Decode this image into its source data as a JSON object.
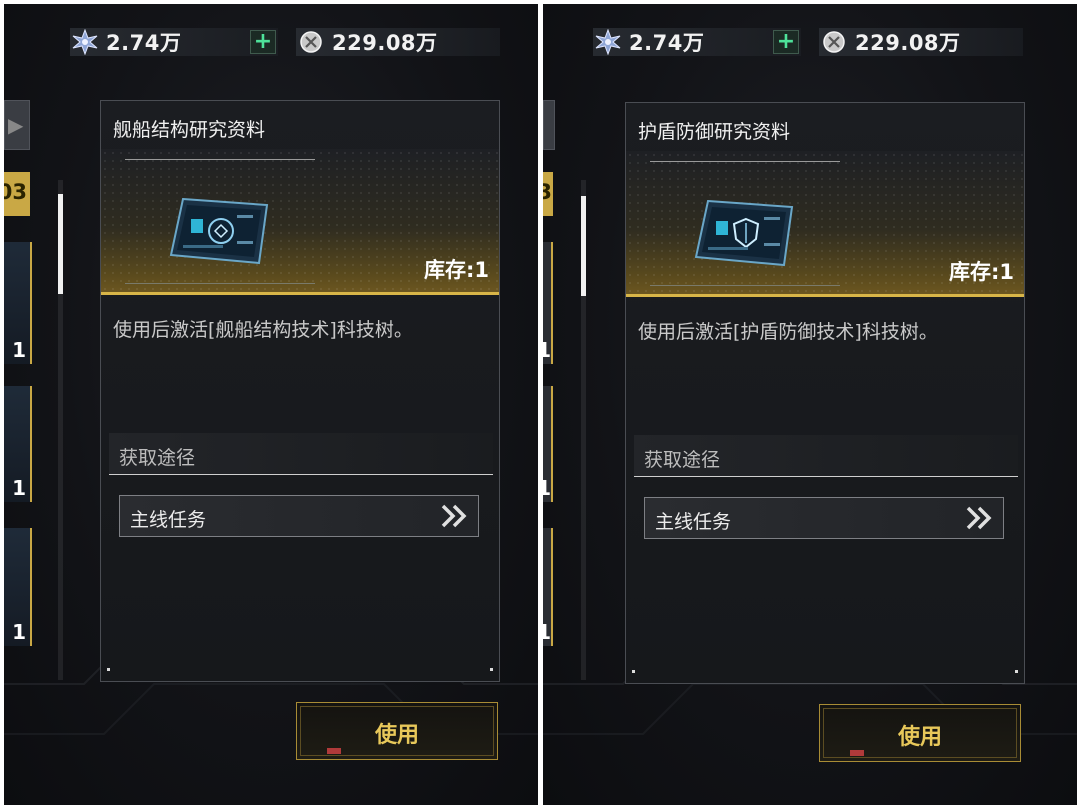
{
  "panels": [
    {
      "resources": {
        "crystal_value": "2.74万",
        "coin_value": "229.08万"
      },
      "item": {
        "name": "舰船结构研究资料",
        "stock": "库存:1",
        "description": "使用后激活[舰船结构技术]科技树。"
      },
      "source": {
        "header": "获取途径",
        "entries": [
          {
            "label": "主线任务"
          }
        ]
      },
      "use_button": "使用",
      "strip": {
        "top_label": "03",
        "counts": [
          "1",
          "1",
          "1"
        ]
      }
    },
    {
      "resources": {
        "crystal_value": "2.74万",
        "coin_value": "229.08万"
      },
      "item": {
        "name": "护盾防御研究资料",
        "stock": "库存:1",
        "description": "使用后激活[护盾防御技术]科技树。"
      },
      "source": {
        "header": "获取途径",
        "entries": [
          {
            "label": "主线任务"
          }
        ]
      },
      "use_button": "使用",
      "strip": {
        "top_label": "3",
        "counts": [
          "1",
          "1",
          "1"
        ]
      }
    }
  ],
  "icons": {
    "crystal": "star-crystal-icon",
    "coin": "coin-icon",
    "plus": "plus-icon",
    "chevron": "double-chevron-right-icon"
  },
  "colors": {
    "accent_gold": "#d8b548",
    "plus_green": "#4ee29a",
    "use_text": "#e8c85a"
  }
}
